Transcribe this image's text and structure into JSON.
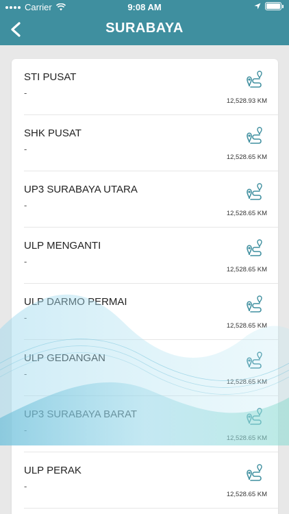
{
  "status_bar": {
    "carrier": "Carrier",
    "time": "9:08 AM"
  },
  "header": {
    "title": "SURABAYA"
  },
  "colors": {
    "header_bg": "#3f8f9f",
    "accent": "#3f8f9f"
  },
  "items": [
    {
      "name": "STI PUSAT",
      "sub": "-",
      "distance": "12,528.93 KM"
    },
    {
      "name": "SHK PUSAT",
      "sub": "-",
      "distance": "12,528.65 KM"
    },
    {
      "name": "UP3 SURABAYA UTARA",
      "sub": "-",
      "distance": "12,528.65 KM"
    },
    {
      "name": "ULP MENGANTI",
      "sub": "-",
      "distance": "12,528.65 KM"
    },
    {
      "name": "ULP DARMO PERMAI",
      "sub": "-",
      "distance": "12,528.65 KM"
    },
    {
      "name": "ULP GEDANGAN",
      "sub": "-",
      "distance": "12,528.65 KM"
    },
    {
      "name": "UP3 SURABAYA BARAT",
      "sub": "-",
      "distance": "12,528.65 KM"
    },
    {
      "name": "ULP PERAK",
      "sub": "-",
      "distance": "12,528.65 KM"
    }
  ]
}
